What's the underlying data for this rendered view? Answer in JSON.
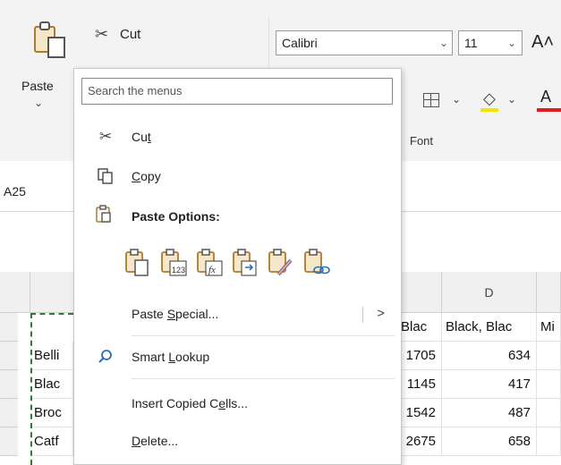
{
  "ribbon": {
    "paste_label": "Paste",
    "paste_dropdown": "⌄",
    "cut_label": "Cut",
    "font_name": "Calibri",
    "font_size": "11",
    "grow_font": "A˄",
    "font_group_label": "Font",
    "highlight_color": "#f4e400",
    "font_color": "#e31b1b"
  },
  "name_box": {
    "value": "A25"
  },
  "context_menu": {
    "search_placeholder": "Search the menus",
    "items": [
      {
        "key": "cut",
        "label_pre": "Cu",
        "label_u": "t",
        "label_post": ""
      },
      {
        "key": "copy",
        "label_pre": "",
        "label_u": "C",
        "label_post": "opy"
      },
      {
        "key": "paste_options",
        "label": "Paste Options:"
      },
      {
        "key": "paste_special",
        "label_pre": "Paste ",
        "label_u": "S",
        "label_post": "pecial...",
        "arrow": ">"
      },
      {
        "key": "smart_lookup",
        "label_pre": "Smart ",
        "label_u": "L",
        "label_post": "ookup"
      },
      {
        "key": "insert_copied",
        "label_pre": "Insert Copied C",
        "label_u": "e",
        "label_post": "lls..."
      },
      {
        "key": "delete",
        "label_pre": "",
        "label_u": "D",
        "label_post": "elete..."
      }
    ],
    "paste_option_icons": [
      "paste-icon",
      "paste-values-icon",
      "paste-formulas-icon",
      "paste-transpose-icon",
      "paste-formatting-icon",
      "paste-link-icon"
    ],
    "paste_option_sublabels": [
      "123",
      "fx"
    ]
  },
  "grid": {
    "col_d_header": "D",
    "header_row": {
      "c": "Blac",
      "d": "Black, Blac",
      "e": "Mi"
    },
    "rows": [
      {
        "a": "Belli",
        "c": "1705",
        "d": "634"
      },
      {
        "a": "Blac",
        "c": "1145",
        "d": "417"
      },
      {
        "a": "Broc",
        "c": "1542",
        "d": "487"
      },
      {
        "a": "Catf",
        "c": "2675",
        "d": "658"
      }
    ]
  }
}
